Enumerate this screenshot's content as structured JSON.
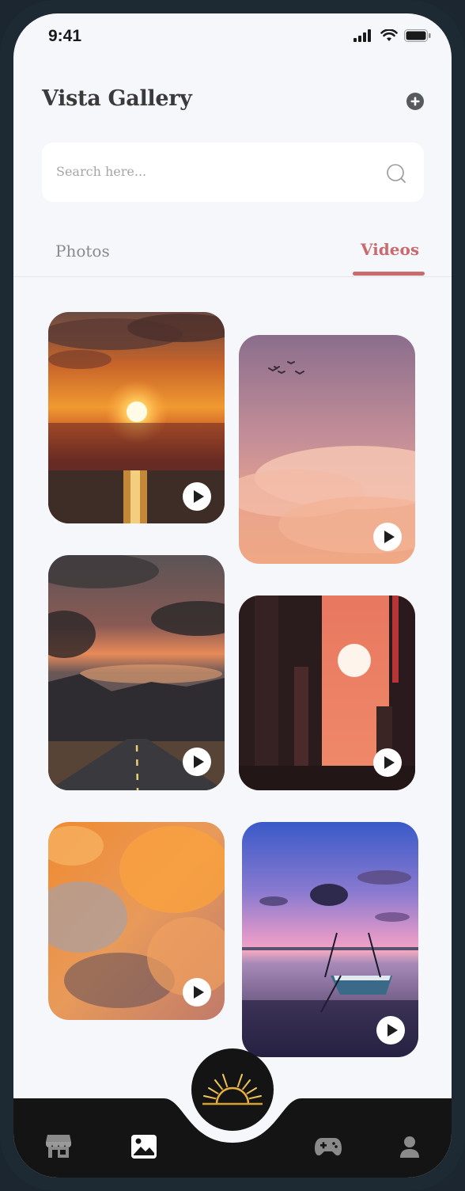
{
  "status_bar": {
    "time": "9:41"
  },
  "header": {
    "title": "Vista Gallery",
    "add_icon": "plus-circle-icon"
  },
  "search": {
    "placeholder": "Search here...",
    "icon": "search-icon"
  },
  "tabs": [
    {
      "label": "Photos",
      "active": false
    },
    {
      "label": "Videos",
      "active": true
    }
  ],
  "colors": {
    "accent": "#c96a6e",
    "background": "#f6f7fb",
    "nav": "#141414"
  },
  "videos": [
    {
      "name": "ocean-sunset"
    },
    {
      "name": "pink-sky-birds"
    },
    {
      "name": "mountain-road"
    },
    {
      "name": "city-sun"
    },
    {
      "name": "orange-clouds"
    },
    {
      "name": "boat-lake"
    }
  ],
  "bottom_nav": [
    {
      "icon": "store-icon"
    },
    {
      "icon": "gallery-icon",
      "active": true
    },
    {
      "icon": "sunrise-logo-icon"
    },
    {
      "icon": "gamepad-icon"
    },
    {
      "icon": "user-icon"
    }
  ]
}
